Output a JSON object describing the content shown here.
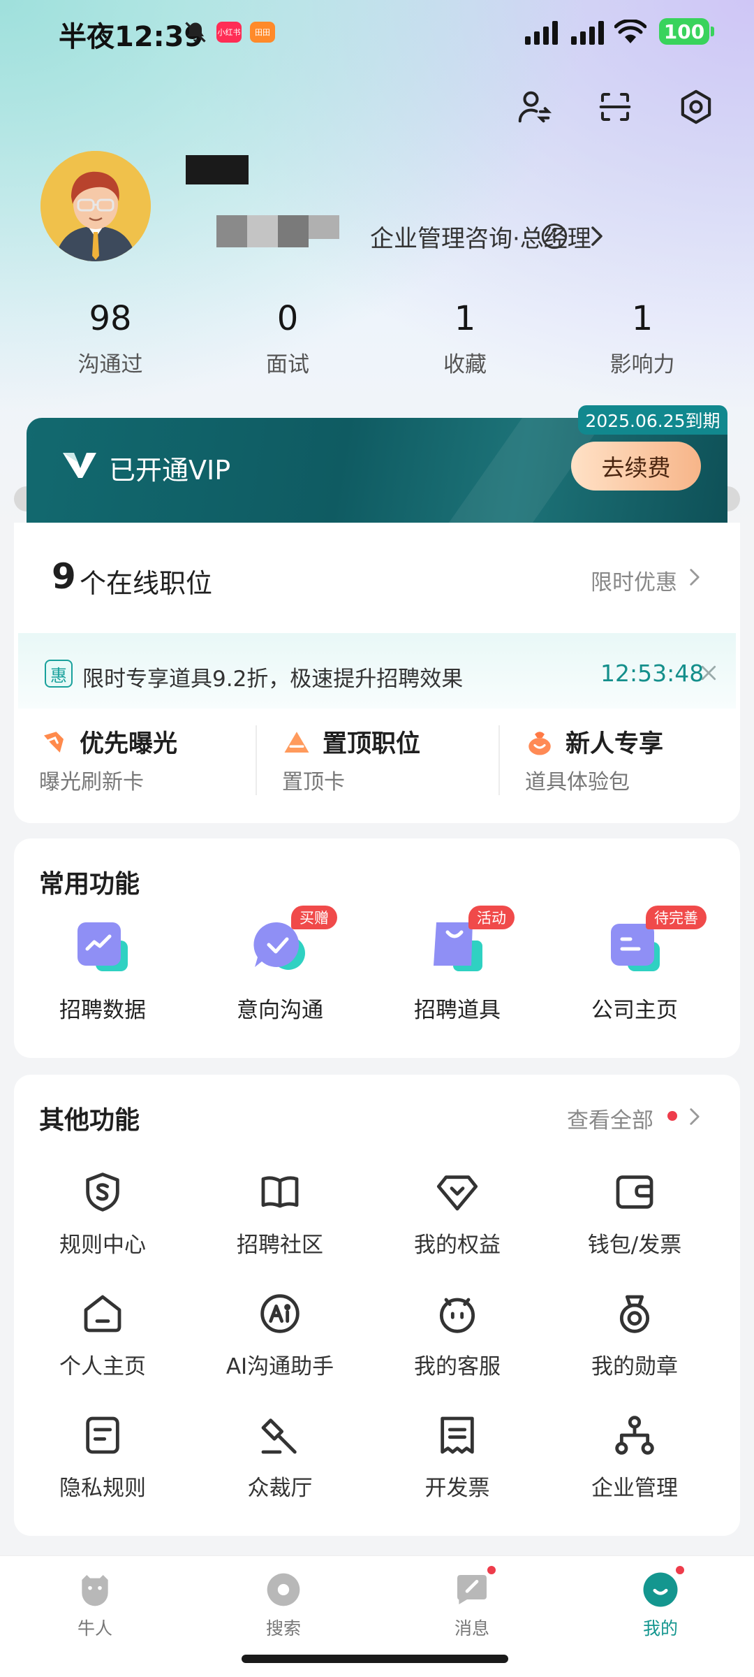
{
  "status_bar": {
    "time": "半夜12:39",
    "battery": "100",
    "app_icons": [
      "小红书",
      "田田"
    ]
  },
  "profile": {
    "title": "企业管理咨询·总经理"
  },
  "stats": [
    {
      "value": "98",
      "label": "沟通过"
    },
    {
      "value": "0",
      "label": "面试"
    },
    {
      "value": "1",
      "label": "收藏"
    },
    {
      "value": "1",
      "label": "影响力"
    }
  ],
  "vip": {
    "label": "已开通VIP",
    "expire": "2025.06.25到期",
    "renew": "去续费",
    "colors": {
      "card": "#0f5b62",
      "accent": "#11888e"
    }
  },
  "jobs": {
    "count": "9",
    "label": "个在线职位",
    "promo_link": "限时优惠"
  },
  "promo": {
    "tag": "惠",
    "text": "限时专享道具9.2折，极速提升招聘效果",
    "timer": "12:53:48"
  },
  "tools": [
    {
      "title": "优先曝光",
      "sub": "曝光刷新卡",
      "icon": "boost-icon"
    },
    {
      "title": "置顶职位",
      "sub": "置顶卡",
      "icon": "pin-top-icon"
    },
    {
      "title": "新人专享",
      "sub": "道具体验包",
      "icon": "gift-bag-icon"
    }
  ],
  "common": {
    "title": "常用功能",
    "items": [
      {
        "label": "招聘数据",
        "badge": ""
      },
      {
        "label": "意向沟通",
        "badge": "买赠"
      },
      {
        "label": "招聘道具",
        "badge": "活动"
      },
      {
        "label": "公司主页",
        "badge": "待完善"
      }
    ]
  },
  "other": {
    "title": "其他功能",
    "view_all": "查看全部",
    "items": [
      {
        "label": "规则中心",
        "icon": "shield-s-icon"
      },
      {
        "label": "招聘社区",
        "icon": "book-icon"
      },
      {
        "label": "我的权益",
        "icon": "diamond-icon"
      },
      {
        "label": "钱包/发票",
        "icon": "wallet-icon"
      },
      {
        "label": "个人主页",
        "icon": "home-icon"
      },
      {
        "label": "AI沟通助手",
        "icon": "ai-icon"
      },
      {
        "label": "我的客服",
        "icon": "service-icon"
      },
      {
        "label": "我的勋章",
        "icon": "medal-icon"
      },
      {
        "label": "隐私规则",
        "icon": "document-icon"
      },
      {
        "label": "众裁厅",
        "icon": "gavel-icon"
      },
      {
        "label": "开发票",
        "icon": "invoice-icon"
      },
      {
        "label": "企业管理",
        "icon": "org-chart-icon"
      }
    ]
  },
  "nav": [
    {
      "label": "牛人",
      "icon": "talent-icon"
    },
    {
      "label": "搜索",
      "icon": "search-icon"
    },
    {
      "label": "消息",
      "icon": "message-icon"
    },
    {
      "label": "我的",
      "icon": "profile-icon"
    }
  ]
}
